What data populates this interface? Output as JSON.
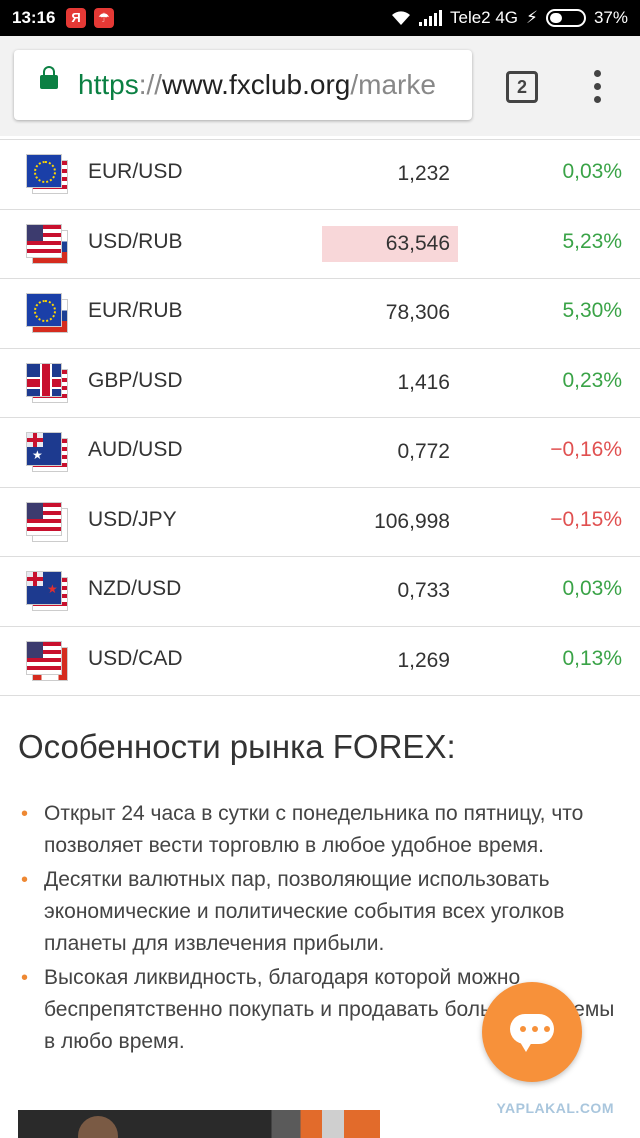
{
  "status_bar": {
    "time": "13:16",
    "app_icons": [
      "Я",
      "☂"
    ],
    "carrier": "Tele2 4G",
    "battery": "37%"
  },
  "browser": {
    "url_scheme": "https",
    "url_sep": "://",
    "url_host": "www.fxclub.org",
    "url_path": "/marke",
    "tab_count": "2"
  },
  "quotes": [
    {
      "pair": "EUR/USD",
      "price": "1,232",
      "change": "0,03%",
      "direction": "up",
      "flags": [
        "eu",
        "us"
      ],
      "highlight": false
    },
    {
      "pair": "USD/RUB",
      "price": "63,546",
      "change": "5,23%",
      "direction": "up",
      "flags": [
        "us",
        "ru"
      ],
      "highlight": true
    },
    {
      "pair": "EUR/RUB",
      "price": "78,306",
      "change": "5,30%",
      "direction": "up",
      "flags": [
        "eu",
        "ru"
      ],
      "highlight": false
    },
    {
      "pair": "GBP/USD",
      "price": "1,416",
      "change": "0,23%",
      "direction": "up",
      "flags": [
        "gb",
        "us"
      ],
      "highlight": false
    },
    {
      "pair": "AUD/USD",
      "price": "0,772",
      "change": "−0,16%",
      "direction": "down",
      "flags": [
        "au",
        "us"
      ],
      "highlight": false
    },
    {
      "pair": "USD/JPY",
      "price": "106,998",
      "change": "−0,15%",
      "direction": "down",
      "flags": [
        "us",
        "jp"
      ],
      "highlight": false
    },
    {
      "pair": "NZD/USD",
      "price": "0,733",
      "change": "0,03%",
      "direction": "up",
      "flags": [
        "nz",
        "us"
      ],
      "highlight": false
    },
    {
      "pair": "USD/CAD",
      "price": "1,269",
      "change": "0,13%",
      "direction": "up",
      "flags": [
        "us",
        "ca"
      ],
      "highlight": false
    }
  ],
  "features": {
    "title": "Особенности рынка FOREX:",
    "items": [
      "Открыт 24 часа в сутки с понедельника по пятницу, что позволяет вести торговлю в любое удобное время.",
      "Десятки валютных пар, позволяющие использовать экономические и политические события всех уголков планеты для извлечения прибыли.",
      "Высокая ликвидность, благодаря которой можно беспрепятственно покупать и продавать большие объемы в любо время."
    ]
  },
  "watermark": "YAPLAKAL.COM",
  "colors": {
    "positive": "#3aa347",
    "negative": "#e05050",
    "highlight": "#f8d7d9",
    "accent": "#f7913a",
    "secure_green": "#0b8043"
  }
}
